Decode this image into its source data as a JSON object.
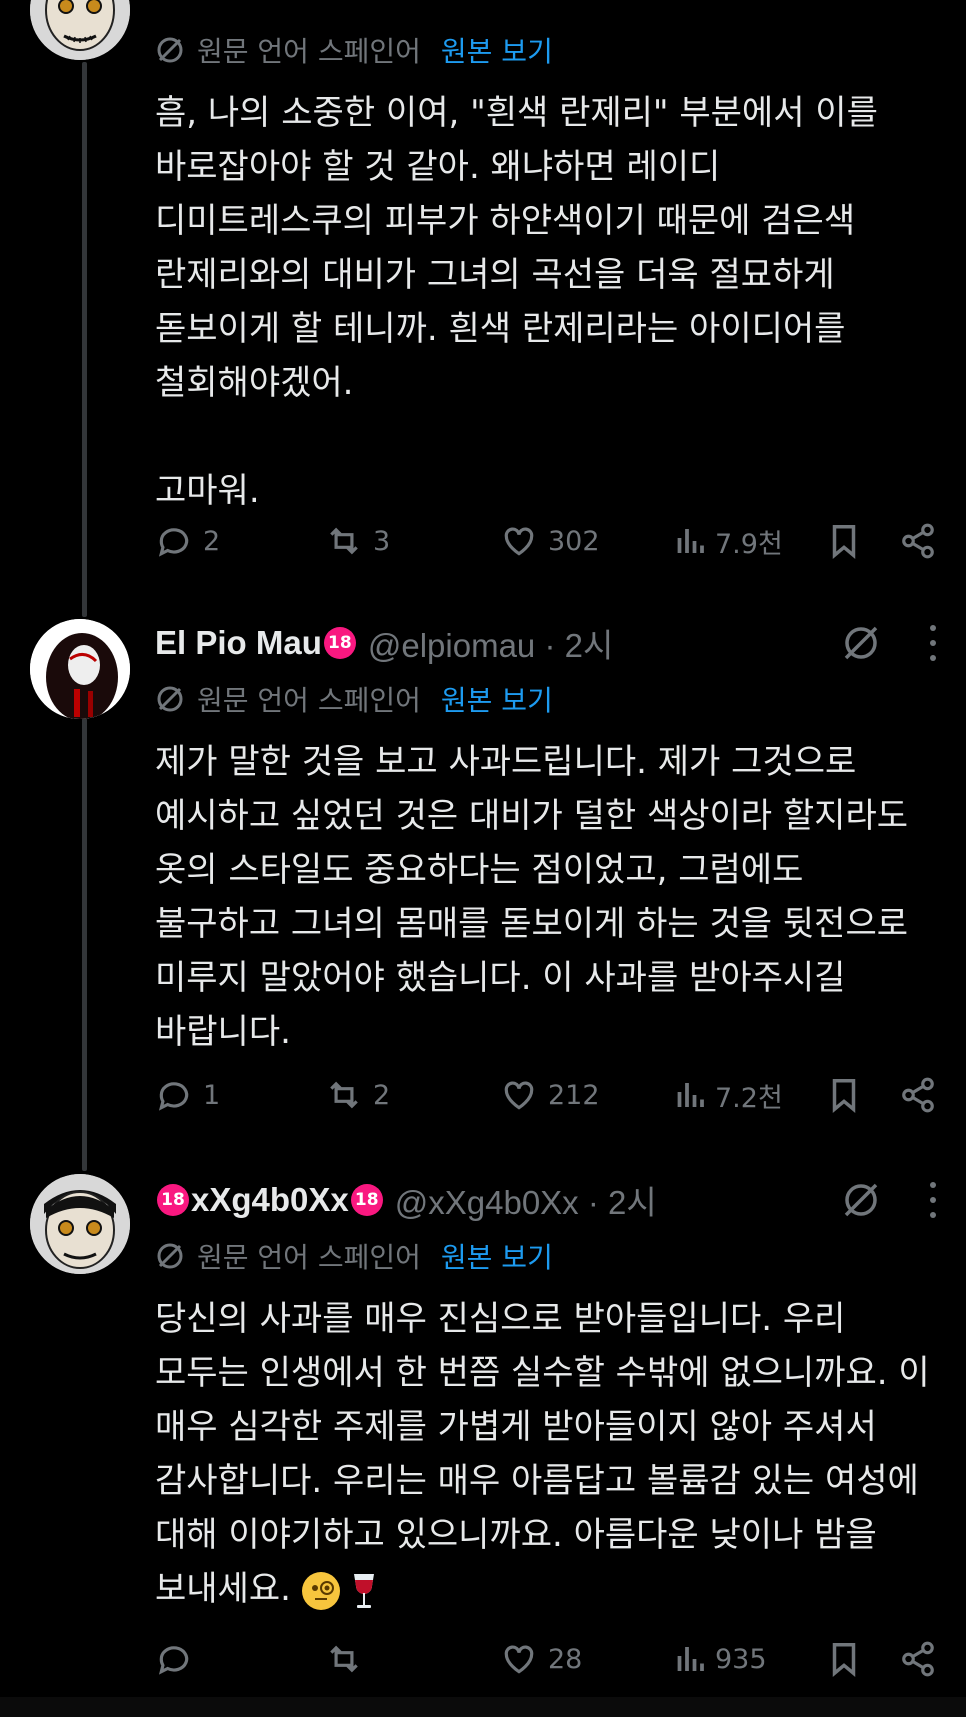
{
  "translate_link": "원본 보기",
  "tweets": [
    {
      "name": "",
      "handle": "",
      "translation_label": "원문 언어 스페인어",
      "text": "흠, 나의 소중한 이여, \"흰색 란제리\" 부분에서 이를\n바로잡아야 할 것 같아. 왜냐하면 레이디\n디미트레스쿠의 피부가 하얀색이기 때문에 검은색\n란제리와의 대비가 그녀의 곡선을 더욱 절묘하게\n돋보이게 할 테니까. 흰색 란제리라는 아이디어를\n철회해야겠어.\n\n고마워.",
      "stats": {
        "replies": "2",
        "retweets": "3",
        "likes": "302",
        "views": "7.9천"
      }
    },
    {
      "name": "El Pio Mau",
      "badge": "18",
      "handle": "@elpiomau · 2시",
      "translation_label": "원문 언어 스페인어",
      "text": "제가 말한 것을 보고 사과드립니다. 제가 그것으로\n예시하고 싶었던 것은 대비가 덜한 색상이라 할지라도\n옷의 스타일도 중요하다는 점이었고, 그럼에도\n불구하고 그녀의 몸매를 돋보이게 하는 것을 뒷전으로\n미루지 말았어야 했습니다. 이 사과를 받아주시길\n바랍니다.",
      "stats": {
        "replies": "1",
        "retweets": "2",
        "likes": "212",
        "views": "7.2천"
      }
    },
    {
      "name": "xXg4b0Xx",
      "badge": "18",
      "handle": "@xXg4b0Xx · 2시",
      "translation_label": "원문 언어 스페인어",
      "text": "당신의 사과를 매우 진심으로 받아들입니다. 우리\n모두는 인생에서 한 번쯤 실수할 수밖에 없으니까요. 이\n매우 심각한 주제를 가볍게 받아들이지 않아 주셔서\n감사합니다. 우리는 매우 아름답고 볼륨감 있는 여성에\n대해 이야기하고 있으니까요. 아름다운 낮이나 밤을\n보내세요.",
      "emojis": [
        "monocle-face",
        "wine-glass"
      ],
      "stats": {
        "replies": "",
        "retweets": "",
        "likes": "28",
        "views": "935"
      }
    }
  ],
  "colors": {
    "background": "#000000",
    "text": "#e7e9ea",
    "muted": "#71767b",
    "link": "#1d9bf0",
    "badge": "#f91880"
  }
}
